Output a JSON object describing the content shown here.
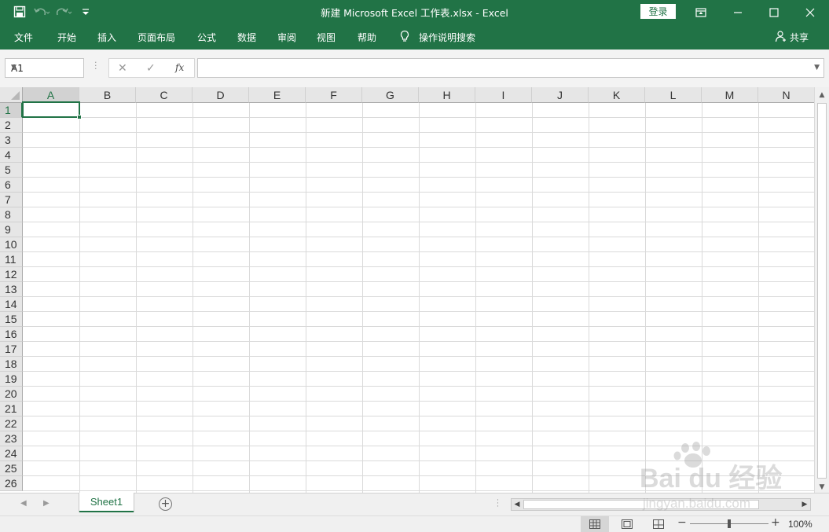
{
  "window": {
    "title": "新建 Microsoft Excel 工作表.xlsx  -  Excel",
    "login_label": "登录",
    "icons": [
      "save-icon",
      "undo-icon",
      "redo-icon",
      "customize-qat-icon",
      "ribbon-display-icon",
      "minimize-icon",
      "maximize-icon",
      "close-icon"
    ]
  },
  "menu": {
    "tabs": [
      "文件",
      "开始",
      "插入",
      "页面布局",
      "公式",
      "数据",
      "审阅",
      "视图",
      "帮助"
    ],
    "tell_me": "操作说明搜索",
    "share": "共享"
  },
  "formula_bar": {
    "name_box": "A1",
    "fx_label": "fx",
    "formula": ""
  },
  "grid": {
    "columns": [
      "A",
      "B",
      "C",
      "D",
      "E",
      "F",
      "G",
      "H",
      "I",
      "J",
      "K",
      "L",
      "M",
      "N"
    ],
    "rows": [
      "1",
      "2",
      "3",
      "4",
      "5",
      "6",
      "7",
      "8",
      "9",
      "10",
      "11",
      "12",
      "13",
      "14",
      "15",
      "16",
      "17",
      "18",
      "19",
      "20",
      "21",
      "22",
      "23",
      "24",
      "25",
      "26"
    ],
    "active_cell": "A1"
  },
  "sheets": {
    "tabs": [
      "Sheet1"
    ],
    "active": "Sheet1",
    "add_label": "+"
  },
  "status": {
    "zoom_level": "100%",
    "zoom_minus": "−",
    "zoom_plus": "+",
    "zoom_fraction": 0.5,
    "view_active": "normal"
  },
  "watermark": {
    "line1": "Bai du 经验",
    "line2": "jingyan.baidu.com"
  },
  "colors": {
    "accent": "#217346",
    "grid_line": "#dadada",
    "header_bg": "#e6e6e6"
  }
}
